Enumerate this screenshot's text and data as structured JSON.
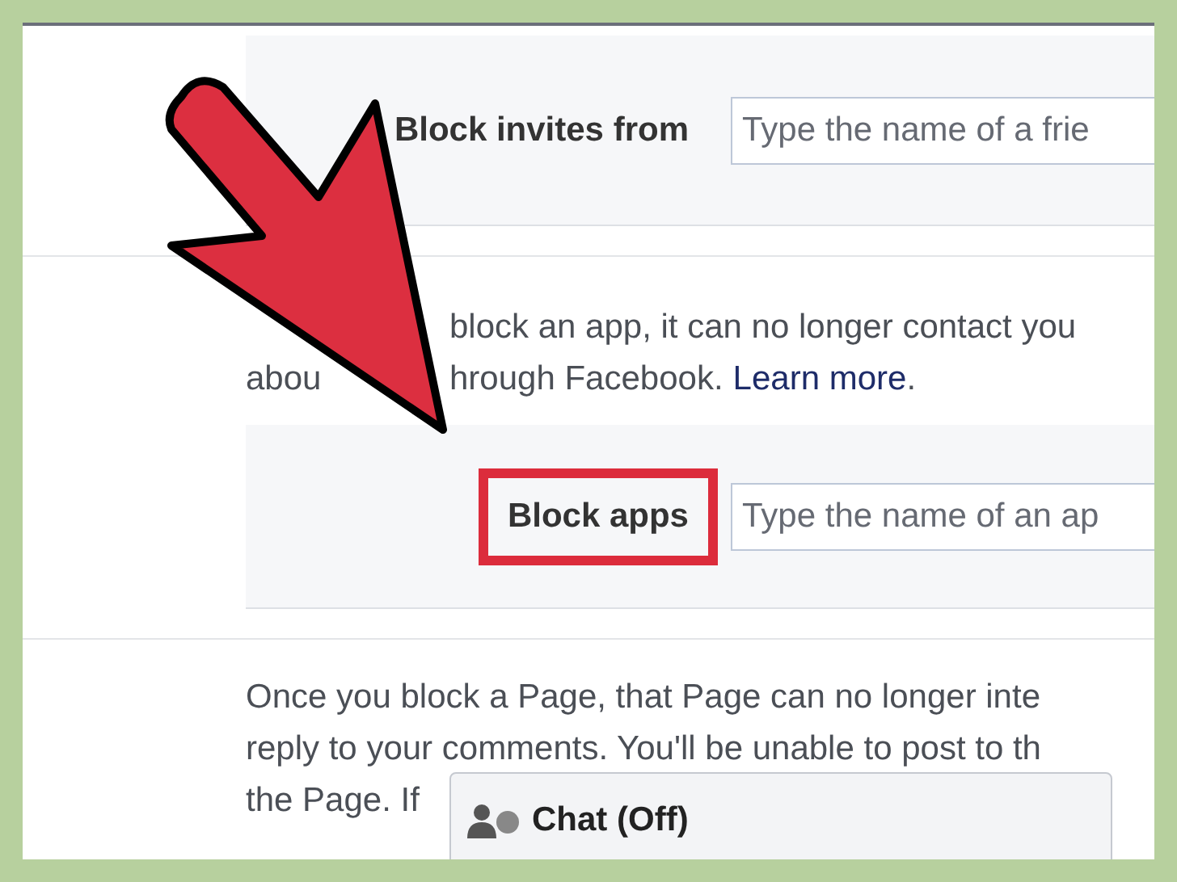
{
  "sections": [
    {
      "kind": "field_row",
      "label": "Block invites from",
      "placeholder": "Type the name of a frie",
      "highlighted": false
    },
    {
      "kind": "covered_paragraph",
      "lines": [
        {
          "parts": [
            {
              "kind": "text",
              "text": "block an app, it can no longer contact you"
            }
          ]
        },
        {
          "lead": "abou",
          "parts": [
            {
              "kind": "text",
              "text": "hrough Facebook."
            },
            {
              "kind": "link",
              "text": "Learn more"
            },
            {
              "kind": "text",
              "text": "."
            }
          ]
        }
      ]
    },
    {
      "kind": "field_row",
      "label": "Block apps",
      "placeholder": "Type the name of an ap",
      "highlighted": true
    },
    {
      "kind": "paragraph",
      "lines": [
        "Once you block a Page, that Page can no longer inte",
        "reply to your comments. You'll be unable to post to th",
        "the Page. If"
      ]
    }
  ],
  "chat_bar": {
    "label": "Chat (Off)"
  }
}
